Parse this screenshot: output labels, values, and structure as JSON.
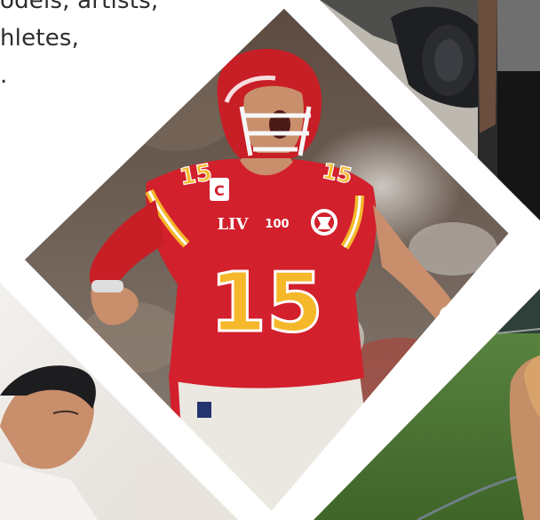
{
  "intro": {
    "lines": [
      "odels, artists,",
      "hletes,",
      "."
    ]
  },
  "tiles": {
    "main": {
      "name": "football-player-tile"
    },
    "top_right": {
      "name": "car-and-man-tile"
    },
    "bottom_left": {
      "name": "man-at-desk-tile"
    },
    "bottom_right": {
      "name": "woman-in-field-tile"
    }
  },
  "jersey": {
    "number": "15",
    "captain_patch": "C",
    "superbowl_patch": "LIV",
    "nfl_anniversary_patch": "100"
  },
  "colors": {
    "chiefs_red": "#d2202c",
    "chiefs_gold": "#f5b82a",
    "helmet_red": "#c81e26",
    "grass_green": "#4f7a36",
    "background": "#ffffff"
  }
}
